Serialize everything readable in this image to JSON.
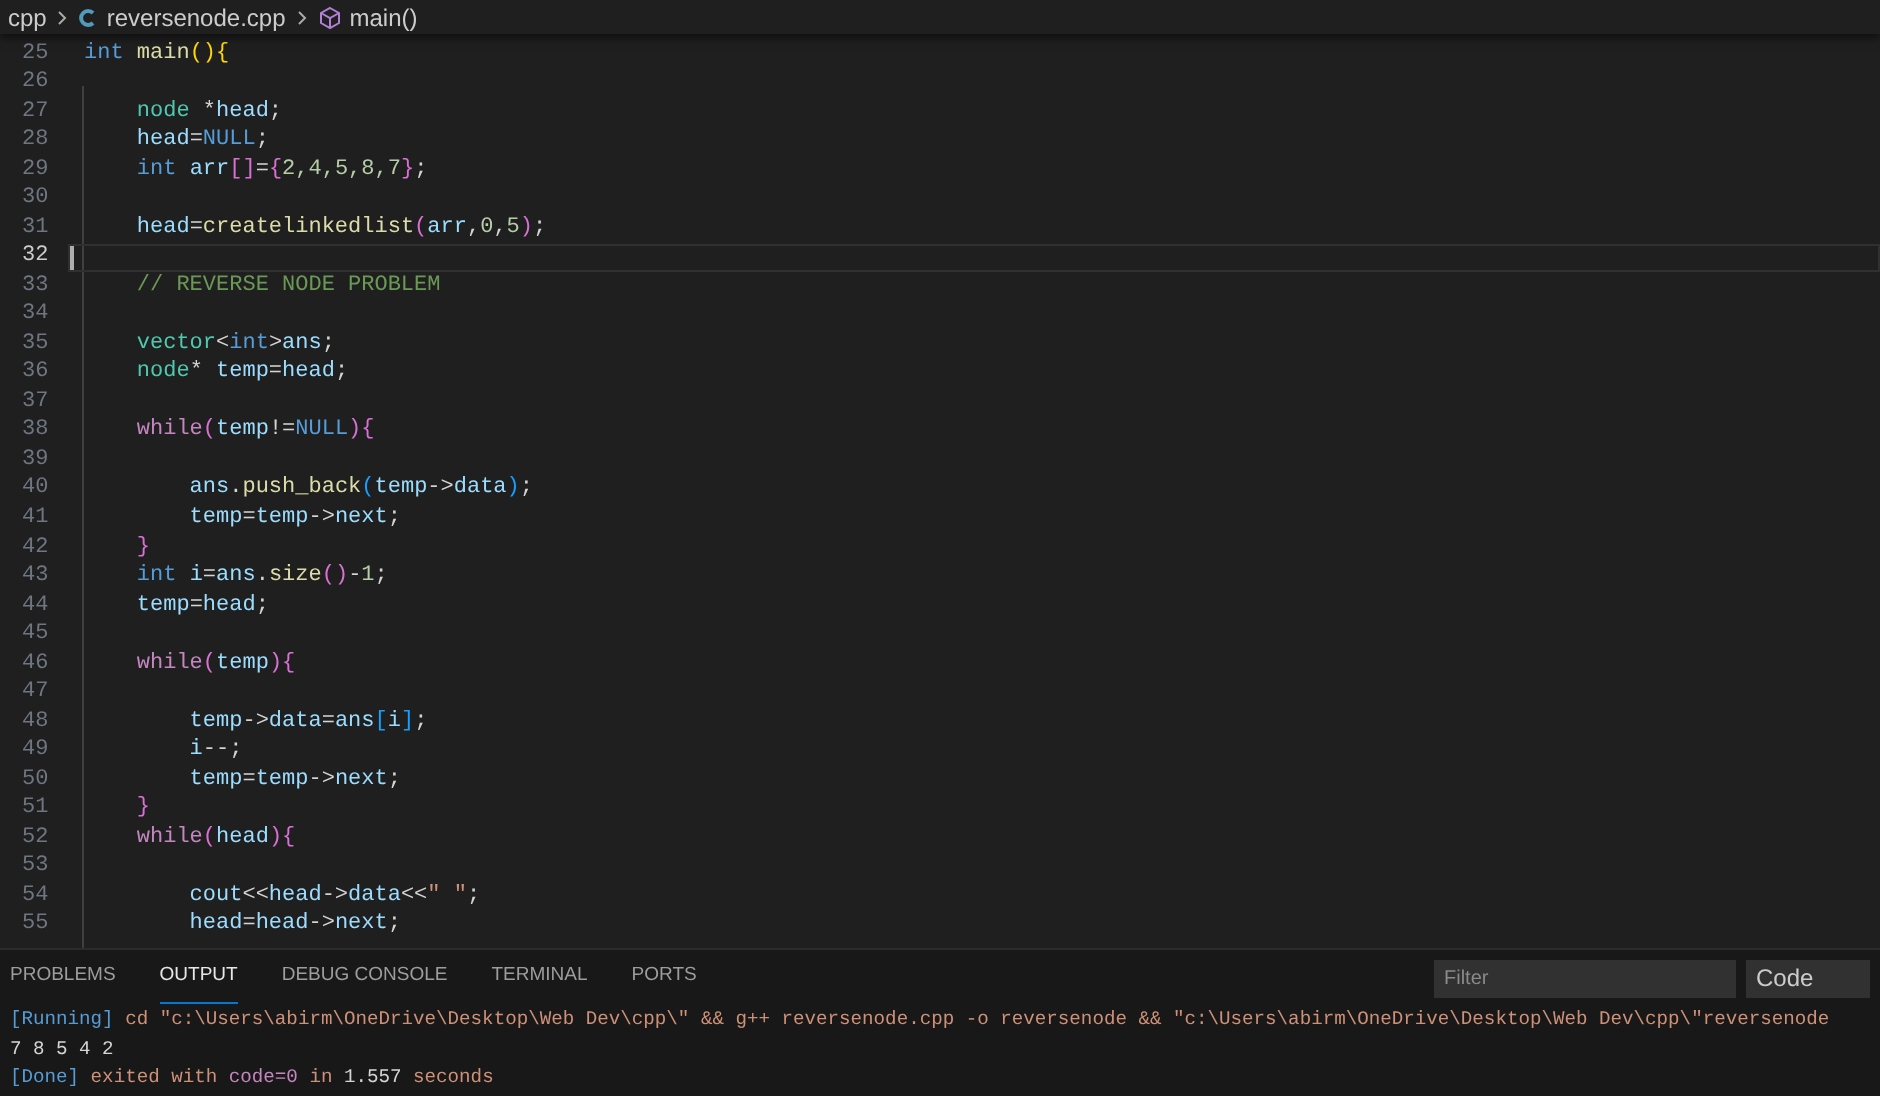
{
  "breadcrumb": [
    {
      "text": "cpp",
      "kind": "folder"
    },
    {
      "text": "reversenode.cpp",
      "kind": "file"
    },
    {
      "text": "main()",
      "kind": "symbol"
    }
  ],
  "editor": {
    "lines": [
      {
        "number": "25",
        "current": false,
        "tokens": [
          {
            "text": "int",
            "kind": "keyword"
          },
          {
            "text": " main",
            "kind": "function"
          },
          {
            "text": "()",
            "kind": "bracket"
          },
          {
            "text": "{",
            "kind": "bracket"
          }
        ]
      },
      {
        "number": "26",
        "current": false
      },
      {
        "number": "27",
        "current": false,
        "tokens": [
          {
            "text": "    node",
            "kind": "type"
          },
          {
            "text": " *",
            "kind": "plain"
          },
          {
            "text": "head",
            "kind": "variable"
          },
          {
            "text": ";",
            "kind": "plain"
          }
        ]
      },
      {
        "number": "28",
        "current": false,
        "tokens": [
          {
            "text": "    head",
            "kind": "variable"
          },
          {
            "text": "=",
            "kind": "plain"
          },
          {
            "text": "NULL",
            "kind": "keyword"
          },
          {
            "text": ";",
            "kind": "plain"
          }
        ]
      },
      {
        "number": "29",
        "current": false,
        "tokens": [
          {
            "text": "    int",
            "kind": "keyword"
          },
          {
            "text": " arr",
            "kind": "variable"
          },
          {
            "text": "[]",
            "kind": "bracket2"
          },
          {
            "text": "=",
            "kind": "plain"
          },
          {
            "text": "{",
            "kind": "bracket2"
          },
          {
            "text": "2,4,5,8,7",
            "kind": "number"
          },
          {
            "text": "}",
            "kind": "bracket2"
          },
          {
            "text": ";",
            "kind": "plain"
          }
        ]
      },
      {
        "number": "30",
        "current": false
      },
      {
        "number": "31",
        "current": false,
        "tokens": [
          {
            "text": "    head",
            "kind": "variable"
          },
          {
            "text": "=",
            "kind": "plain"
          },
          {
            "text": "createlinkedlist",
            "kind": "function"
          },
          {
            "text": "(",
            "kind": "bracket2"
          },
          {
            "text": "arr",
            "kind": "variable"
          },
          {
            "text": ",",
            "kind": "plain"
          },
          {
            "text": "0",
            "kind": "number"
          },
          {
            "text": ",",
            "kind": "plain"
          },
          {
            "text": "5",
            "kind": "number"
          },
          {
            "text": ")",
            "kind": "bracket2"
          },
          {
            "text": ";",
            "kind": "plain"
          }
        ]
      },
      {
        "number": "32",
        "current": true
      },
      {
        "number": "33",
        "current": false,
        "tokens": [
          {
            "text": "    // REVERSE NODE PROBLEM",
            "kind": "comment"
          }
        ]
      },
      {
        "number": "34",
        "current": false
      },
      {
        "number": "35",
        "current": false,
        "tokens": [
          {
            "text": "    vector",
            "kind": "type"
          },
          {
            "text": "<",
            "kind": "plain"
          },
          {
            "text": "int",
            "kind": "keyword"
          },
          {
            "text": ">",
            "kind": "plain"
          },
          {
            "text": "ans",
            "kind": "variable"
          },
          {
            "text": ";",
            "kind": "plain"
          }
        ]
      },
      {
        "number": "36",
        "current": false,
        "tokens": [
          {
            "text": "    node",
            "kind": "type"
          },
          {
            "text": "* ",
            "kind": "plain"
          },
          {
            "text": "temp",
            "kind": "variable"
          },
          {
            "text": "=",
            "kind": "plain"
          },
          {
            "text": "head",
            "kind": "variable"
          },
          {
            "text": ";",
            "kind": "plain"
          }
        ]
      },
      {
        "number": "37",
        "current": false
      },
      {
        "number": "38",
        "current": false,
        "tokens": [
          {
            "text": "    while",
            "kind": "control"
          },
          {
            "text": "(",
            "kind": "bracket2"
          },
          {
            "text": "temp",
            "kind": "variable"
          },
          {
            "text": "!=",
            "kind": "plain"
          },
          {
            "text": "NULL",
            "kind": "keyword"
          },
          {
            "text": "){",
            "kind": "bracket2"
          }
        ]
      },
      {
        "number": "39",
        "current": false
      },
      {
        "number": "40",
        "current": false,
        "tokens": [
          {
            "text": "        ans",
            "kind": "variable"
          },
          {
            "text": ".",
            "kind": "plain"
          },
          {
            "text": "push_back",
            "kind": "function"
          },
          {
            "text": "(",
            "kind": "bracket3"
          },
          {
            "text": "temp",
            "kind": "variable"
          },
          {
            "text": "->",
            "kind": "plain"
          },
          {
            "text": "data",
            "kind": "variable"
          },
          {
            "text": ")",
            "kind": "bracket3"
          },
          {
            "text": ";",
            "kind": "plain"
          }
        ]
      },
      {
        "number": "41",
        "current": false,
        "tokens": [
          {
            "text": "        temp",
            "kind": "variable"
          },
          {
            "text": "=",
            "kind": "plain"
          },
          {
            "text": "temp",
            "kind": "variable"
          },
          {
            "text": "->",
            "kind": "plain"
          },
          {
            "text": "next",
            "kind": "variable"
          },
          {
            "text": ";",
            "kind": "plain"
          }
        ]
      },
      {
        "number": "42",
        "current": false,
        "tokens": [
          {
            "text": "    }",
            "kind": "bracket2"
          }
        ]
      },
      {
        "number": "43",
        "current": false,
        "tokens": [
          {
            "text": "    int",
            "kind": "keyword"
          },
          {
            "text": " i",
            "kind": "variable"
          },
          {
            "text": "=",
            "kind": "plain"
          },
          {
            "text": "ans",
            "kind": "variable"
          },
          {
            "text": ".",
            "kind": "plain"
          },
          {
            "text": "size",
            "kind": "function"
          },
          {
            "text": "()",
            "kind": "bracket2"
          },
          {
            "text": "-",
            "kind": "plain"
          },
          {
            "text": "1",
            "kind": "number"
          },
          {
            "text": ";",
            "kind": "plain"
          }
        ]
      },
      {
        "number": "44",
        "current": false,
        "tokens": [
          {
            "text": "    temp",
            "kind": "variable"
          },
          {
            "text": "=",
            "kind": "plain"
          },
          {
            "text": "head",
            "kind": "variable"
          },
          {
            "text": ";",
            "kind": "plain"
          }
        ]
      },
      {
        "number": "45",
        "current": false
      },
      {
        "number": "46",
        "current": false,
        "tokens": [
          {
            "text": "    while",
            "kind": "control"
          },
          {
            "text": "(",
            "kind": "bracket2"
          },
          {
            "text": "temp",
            "kind": "variable"
          },
          {
            "text": "){",
            "kind": "bracket2"
          }
        ]
      },
      {
        "number": "47",
        "current": false
      },
      {
        "number": "48",
        "current": false,
        "tokens": [
          {
            "text": "        temp",
            "kind": "variable"
          },
          {
            "text": "->",
            "kind": "plain"
          },
          {
            "text": "data",
            "kind": "variable"
          },
          {
            "text": "=",
            "kind": "plain"
          },
          {
            "text": "ans",
            "kind": "variable"
          },
          {
            "text": "[",
            "kind": "bracket3"
          },
          {
            "text": "i",
            "kind": "variable"
          },
          {
            "text": "]",
            "kind": "bracket3"
          },
          {
            "text": ";",
            "kind": "plain"
          }
        ]
      },
      {
        "number": "49",
        "current": false,
        "tokens": [
          {
            "text": "        i",
            "kind": "variable"
          },
          {
            "text": "--;",
            "kind": "plain"
          }
        ]
      },
      {
        "number": "50",
        "current": false,
        "tokens": [
          {
            "text": "        temp",
            "kind": "variable"
          },
          {
            "text": "=",
            "kind": "plain"
          },
          {
            "text": "temp",
            "kind": "variable"
          },
          {
            "text": "->",
            "kind": "plain"
          },
          {
            "text": "next",
            "kind": "variable"
          },
          {
            "text": ";",
            "kind": "plain"
          }
        ]
      },
      {
        "number": "51",
        "current": false,
        "tokens": [
          {
            "text": "    }",
            "kind": "bracket2"
          }
        ]
      },
      {
        "number": "52",
        "current": false,
        "tokens": [
          {
            "text": "    while",
            "kind": "control"
          },
          {
            "text": "(",
            "kind": "bracket2"
          },
          {
            "text": "head",
            "kind": "variable"
          },
          {
            "text": "){",
            "kind": "bracket2"
          }
        ]
      },
      {
        "number": "53",
        "current": false
      },
      {
        "number": "54",
        "current": false,
        "tokens": [
          {
            "text": "        cout",
            "kind": "variable"
          },
          {
            "text": "<<",
            "kind": "plain"
          },
          {
            "text": "head",
            "kind": "variable"
          },
          {
            "text": "->",
            "kind": "plain"
          },
          {
            "text": "data",
            "kind": "variable"
          },
          {
            "text": "<<",
            "kind": "plain"
          },
          {
            "text": "\" \"",
            "kind": "string"
          },
          {
            "text": ";",
            "kind": "plain"
          }
        ]
      },
      {
        "number": "55",
        "current": false,
        "tokens": [
          {
            "text": "        head",
            "kind": "variable"
          },
          {
            "text": "=",
            "kind": "plain"
          },
          {
            "text": "head",
            "kind": "variable"
          },
          {
            "text": "->",
            "kind": "plain"
          },
          {
            "text": "next",
            "kind": "variable"
          },
          {
            "text": ";",
            "kind": "plain"
          }
        ]
      }
    ]
  },
  "panel": {
    "tabs": [
      {
        "label": "PROBLEMS",
        "selected": false
      },
      {
        "label": "OUTPUT",
        "selected": true
      },
      {
        "label": "DEBUG CONSOLE",
        "selected": false
      },
      {
        "label": "TERMINAL",
        "selected": false
      },
      {
        "label": "PORTS",
        "selected": false
      }
    ],
    "filter": {
      "placeholder": "Filter"
    },
    "channel": "Code",
    "output": [
      [
        {
          "text": "[Running]",
          "kind": "tag"
        },
        {
          "text": " cd \"c:\\Users\\abirm\\OneDrive\\Desktop\\Web Dev\\cpp\\\" && g++ reversenode.cpp -o reversenode && \"c:\\Users\\abirm\\OneDrive\\Desktop\\Web Dev\\cpp\\\"reversenode",
          "kind": "string"
        }
      ],
      [
        {
          "text": "7 8 5 4 2",
          "kind": "plain"
        }
      ],
      [
        {
          "text": "[Done]",
          "kind": "tag"
        },
        {
          "text": " exited with ",
          "kind": "string"
        },
        {
          "text": "code=0",
          "kind": "code"
        },
        {
          "text": " in ",
          "kind": "string"
        },
        {
          "text": "1.557",
          "kind": "plain"
        },
        {
          "text": " seconds",
          "kind": "string"
        }
      ]
    ]
  }
}
